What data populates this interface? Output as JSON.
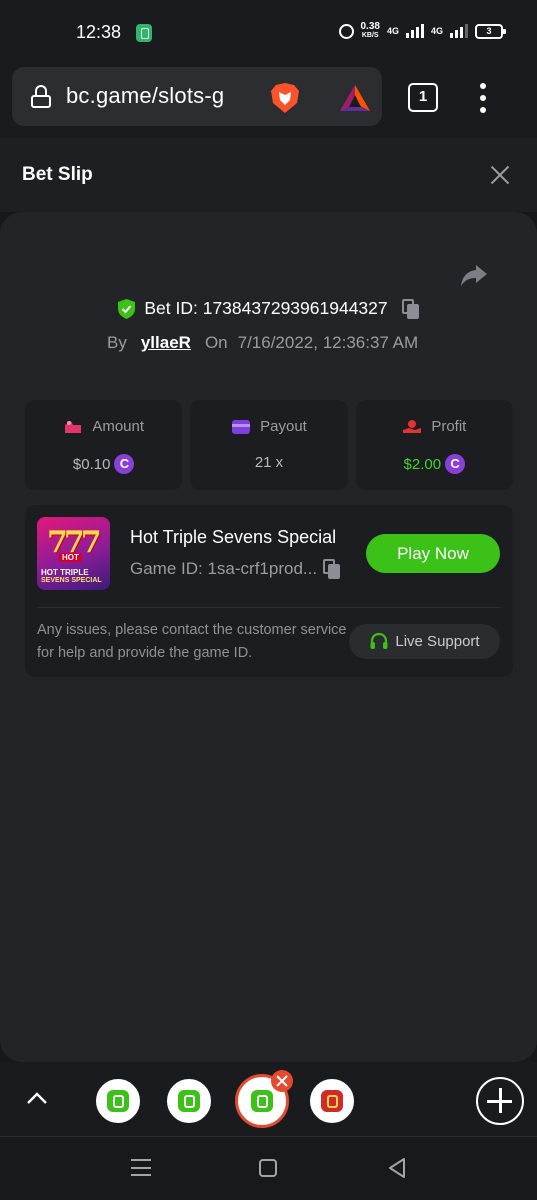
{
  "status_bar": {
    "time": "12:38",
    "speed_value": "0.38",
    "speed_unit": "KB/S",
    "network_label": "4G",
    "battery": "3"
  },
  "browser": {
    "url": "bc.game/slots-g",
    "tab_count": "1"
  },
  "bet_slip": {
    "title": "Bet Slip",
    "bet_id_label": "Bet ID: 1738437293961944327",
    "by_label": "By",
    "username": "yllaeR",
    "on_label": "On",
    "datetime": "7/16/2022, 12:36:37 AM",
    "stats": [
      {
        "label": "Amount",
        "value": "$0.10",
        "icon": "amount-icon",
        "color": "#e2356a",
        "value_color": "#b7b9bd",
        "coin": true
      },
      {
        "label": "Payout",
        "value": "21 x",
        "icon": "card-icon",
        "color": "#7f3ee0",
        "value_color": "#b7b9bd",
        "coin": false
      },
      {
        "label": "Profit",
        "value": "$2.00",
        "icon": "profit-icon",
        "color": "#e03434",
        "value_color": "#43d22b",
        "coin": true
      }
    ],
    "game": {
      "name": "Hot Triple Sevens Special",
      "game_id": "Game ID: 1sa-crf1prod...",
      "thumb_title_1": "HOT TRIPLE",
      "thumb_title_2": "SEVENS SPECIAL",
      "thumb_badge": "HOT",
      "thumb_sevens": "777",
      "play_label": "Play Now"
    },
    "issues_text": "Any issues, please contact the customer service for help and provide the game ID.",
    "support_label": "Live Support"
  },
  "colors": {
    "accent_green": "#3bc117",
    "profit_green": "#43d22b",
    "coin_purple": "#8b3fd9",
    "close_tab_red": "#e64a2e"
  }
}
